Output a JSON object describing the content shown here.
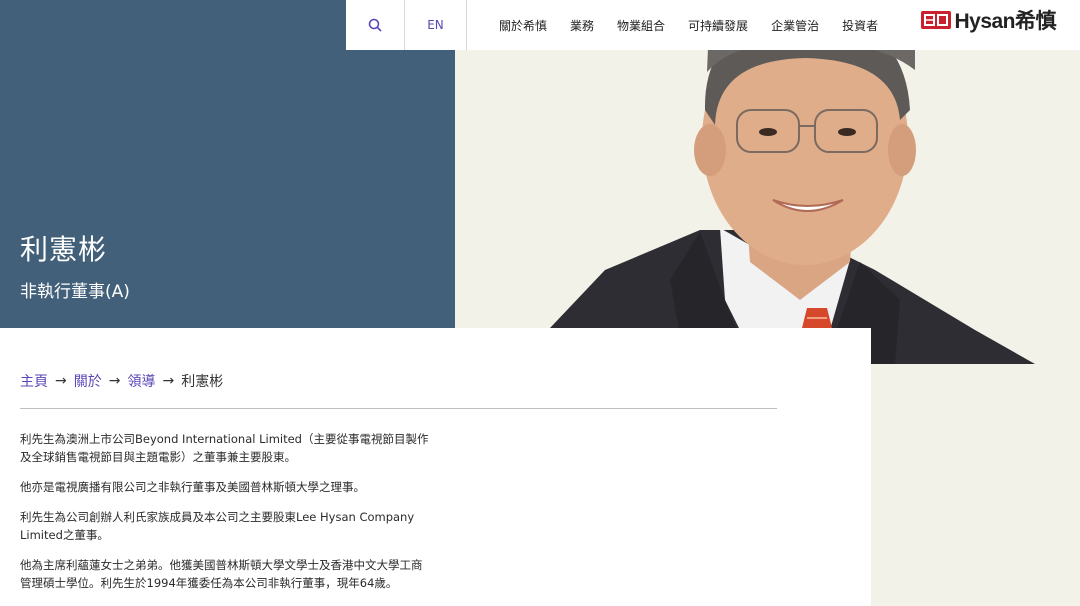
{
  "nav": {
    "search_icon": "search-icon",
    "lang": "EN",
    "links": [
      "關於希慎",
      "業務",
      "物業組合",
      "可持續發展",
      "企業管治",
      "投資者"
    ]
  },
  "logo": {
    "text": "Hysan希慎",
    "color": "#c8202f"
  },
  "hero": {
    "name": "利憲彬",
    "title": "非執行董事(A)",
    "bg_color": "#426079",
    "photo": "portrait-photo"
  },
  "breadcrumb": {
    "home": "主頁",
    "about": "關於",
    "leadership": "領導",
    "current": "利憲彬"
  },
  "bio": [
    "利先生為澳洲上市公司Beyond International Limited（主要從事電視節目製作及全球銷售電視節目與主題電影）之董事兼主要股東。",
    "他亦是電視廣播有限公司之非執行董事及美國普林斯頓大學之理事。",
    "利先生為公司創辦人利氏家族成員及本公司之主要股東Lee Hysan Company Limited之董事。",
    "他為主席利蘊蓮女士之弟弟。他獲美國普林斯頓大學文學士及香港中文大學工商管理碩士學位。利先生於1994年獲委任為本公司非執行董事，現年64歲。"
  ],
  "colors": {
    "accent": "#5b45b8",
    "panel_bg": "#f3f2e8"
  }
}
